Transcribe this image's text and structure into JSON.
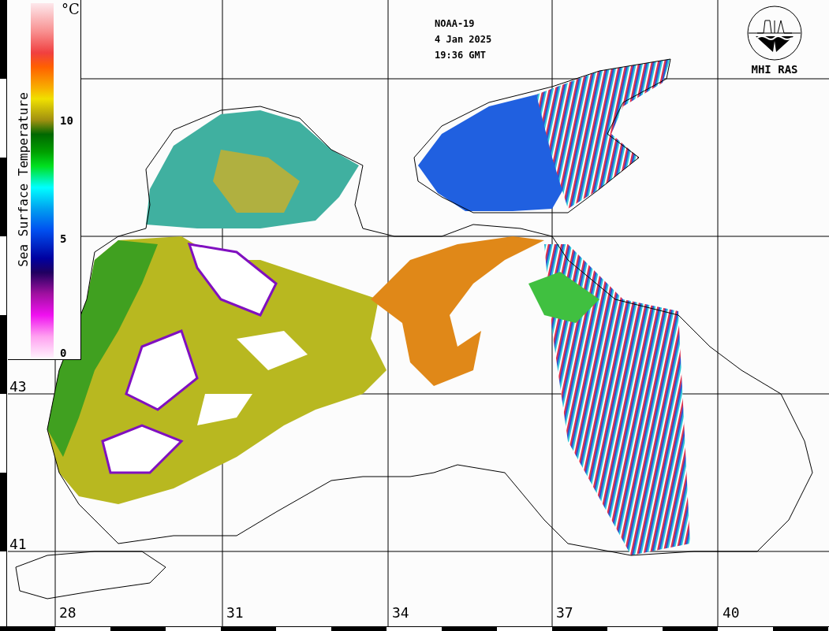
{
  "legend": {
    "title": "Sea Surface Temperature",
    "unit": "°C",
    "ticks": [
      "10",
      "5",
      "0"
    ]
  },
  "info": [
    "NOAA-19",
    "4 Jan 2025",
    "19:36 GMT"
  ],
  "logo": {
    "text": "MHI RAS"
  },
  "latitude_labels": [
    "43",
    "41"
  ],
  "longitude_labels": [
    "28",
    "31",
    "34",
    "37",
    "40"
  ]
}
